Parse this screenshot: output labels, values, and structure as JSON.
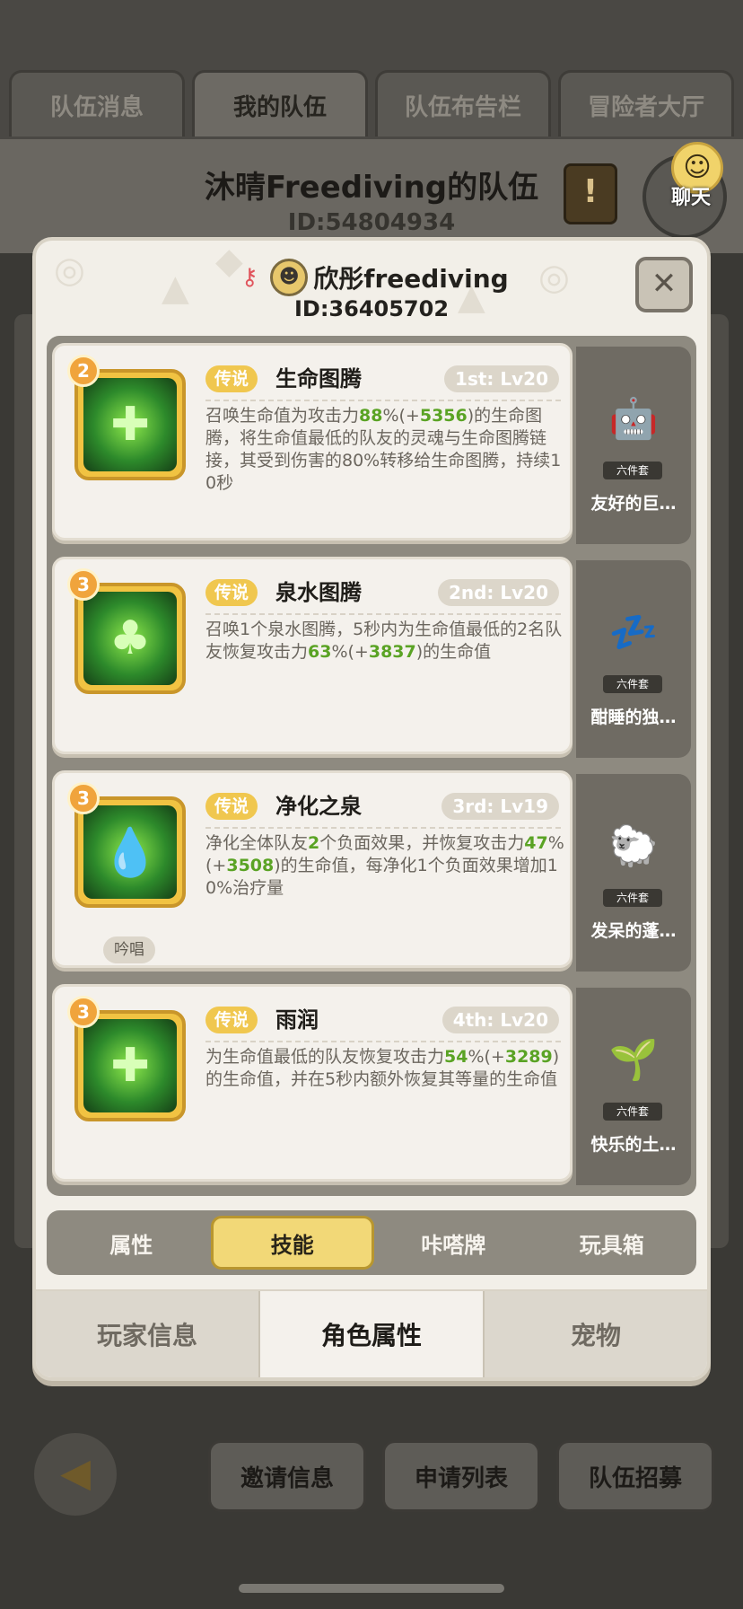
{
  "team_tabs": [
    "队伍消息",
    "我的队伍",
    "队伍布告栏",
    "冒险者大厅"
  ],
  "team": {
    "title": "沐晴Freediving的队伍",
    "id": "ID:54804934"
  },
  "chat": {
    "label": "聊天",
    "icon": "smiley-icon"
  },
  "player": {
    "name": "欣彤freediving",
    "id": "ID:36405702",
    "icons": [
      "key-icon",
      "avatar-icon"
    ]
  },
  "close_label": "✕",
  "skills": [
    {
      "level": "2",
      "rarity": "传说",
      "name": "生命图腾",
      "order": "1st: Lv20",
      "desc_parts": [
        {
          "t": "召唤生命值为攻击力"
        },
        {
          "t": "88",
          "g": true
        },
        {
          "t": "%(+"
        },
        {
          "t": "5356",
          "g": true
        },
        {
          "t": ")的生命图腾，将生命值最低的队友的灵魂与生命图腾链接，其受到伤害的80%转移给生命图腾，持续10秒"
        }
      ],
      "icon": "✚",
      "pet_name": "友好的巨…",
      "pet_set": "六件套",
      "pet_icon": "🤖"
    },
    {
      "level": "3",
      "rarity": "传说",
      "name": "泉水图腾",
      "order": "2nd: Lv20",
      "desc_parts": [
        {
          "t": "召唤1个泉水图腾，5秒内为生命值最低的2名队友恢复攻击力"
        },
        {
          "t": "63",
          "g": true
        },
        {
          "t": "%(+"
        },
        {
          "t": "3837",
          "g": true
        },
        {
          "t": ")的生命值"
        }
      ],
      "icon": "♣",
      "pet_name": "酣睡的独…",
      "pet_set": "六件套",
      "pet_icon": "💤"
    },
    {
      "level": "3",
      "rarity": "传说",
      "name": "净化之泉",
      "order": "3rd: Lv19",
      "desc_parts": [
        {
          "t": "净化全体队友"
        },
        {
          "t": "2",
          "g": true
        },
        {
          "t": "个负面效果，并恢复攻击力"
        },
        {
          "t": "47",
          "g": true
        },
        {
          "t": "%(+"
        },
        {
          "t": "3508",
          "g": true
        },
        {
          "t": ")的生命值，每净化1个负面效果增加10%治疗量"
        }
      ],
      "icon": "💧",
      "chant": "吟唱",
      "pet_name": "发呆的蓬…",
      "pet_set": "六件套",
      "pet_icon": "🐑"
    },
    {
      "level": "3",
      "rarity": "传说",
      "name": "雨润",
      "order": "4th: Lv20",
      "desc_parts": [
        {
          "t": "为生命值最低的队友恢复攻击力"
        },
        {
          "t": "54",
          "g": true
        },
        {
          "t": "%(+"
        },
        {
          "t": "3289",
          "g": true
        },
        {
          "t": ")的生命值，并在5秒内额外恢复其等量的生命值"
        }
      ],
      "icon": "✚",
      "pet_name": "快乐的土…",
      "pet_set": "六件套",
      "pet_icon": "🌱"
    }
  ],
  "sub_tabs": [
    "属性",
    "技能",
    "咔嗒牌",
    "玩具箱"
  ],
  "bottom_tabs": [
    "玩家信息",
    "角色属性",
    "宠物"
  ],
  "footer": {
    "back_icon": "back-arrow-icon",
    "buttons": [
      "邀请信息",
      "申请列表",
      "队伍招募"
    ]
  },
  "colors": {
    "accent": "#f2d877",
    "highlight_green": "#5aa324",
    "rarity": "#f0c74f"
  }
}
